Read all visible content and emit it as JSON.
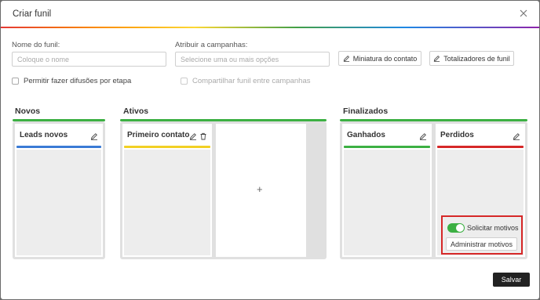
{
  "modal": {
    "title": "Criar funil",
    "save_label": "Salvar"
  },
  "form": {
    "funnel_name_label": "Nome do funil",
    "funnel_name_placeholder": "Coloque o nome",
    "campaigns_label": "Atribuir a campanhas",
    "campaigns_placeholder": "Selecione uma ou mais opções",
    "contact_thumbnail_button": "Miniatura do contato",
    "funnel_totals_button": "Totalizadores de funil",
    "allow_broadcasts_label": "Permitir fazer difusões por etapa",
    "share_funnel_label": "Compartilhar funil entre campanhas"
  },
  "sections": {
    "new": {
      "title": "Novos"
    },
    "active": {
      "title": "Ativos"
    },
    "finished": {
      "title": "Finalizados"
    }
  },
  "columns": {
    "leads_new": {
      "title": "Leads novos",
      "color": "#3a7bd5"
    },
    "first_contact": {
      "title": "Primeiro contato",
      "color": "#f2d024"
    },
    "won": {
      "title": "Ganhados",
      "color": "#3cb043"
    },
    "lost": {
      "title": "Perdidos",
      "color": "#d62828"
    }
  },
  "add_column_symbol": "+",
  "lost_options": {
    "request_reasons_label": "Solicitar motivos",
    "request_reasons_enabled": true,
    "manage_reasons_button": "Administrar motivos"
  },
  "colors": {
    "accent_green": "#3cb043",
    "highlight_red": "#d62828",
    "save_button_bg": "#222222"
  },
  "icons": {
    "close": "close-icon",
    "edit": "pencil-icon",
    "delete": "trash-icon"
  }
}
